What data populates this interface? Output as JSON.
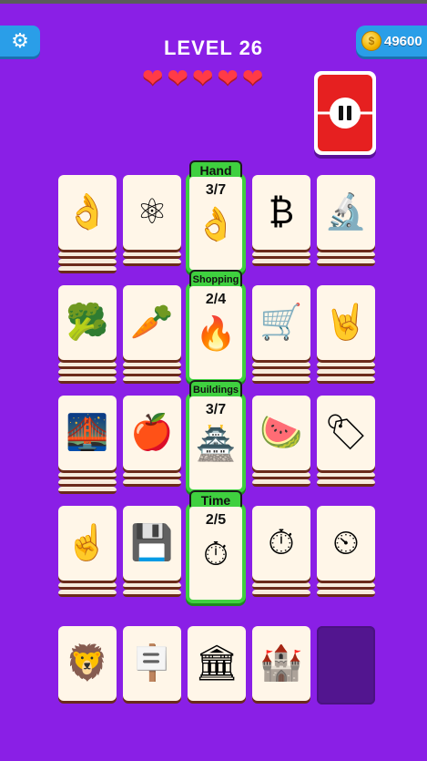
{
  "header": {
    "level": "LEVEL 26",
    "coins": "49600",
    "coin_symbol": "$",
    "settings_glyph": "⚙",
    "lives": [
      "❤",
      "❤",
      "❤",
      "❤",
      "❤"
    ]
  },
  "categories": [
    {
      "label": "Hand",
      "count": "3/7",
      "icon": "👌"
    },
    {
      "label": "Shopping",
      "count": "2/4",
      "icon": "🔥"
    },
    {
      "label": "Buildings",
      "count": "3/7",
      "icon": "🏯"
    },
    {
      "label": "Time",
      "count": "2/5",
      "icon": "⏱"
    }
  ],
  "rows": [
    [
      "👌",
      "⚛",
      "₿",
      "🔬"
    ],
    [
      "🥦",
      "🥕",
      "🛒",
      "🤘"
    ],
    [
      "🌉",
      "🍎",
      "🍉",
      "🏷"
    ],
    [
      "☝",
      "💾",
      "⏱",
      "⏲"
    ]
  ],
  "tray": [
    "🦁",
    "🪧",
    "🏛",
    "🏰"
  ]
}
